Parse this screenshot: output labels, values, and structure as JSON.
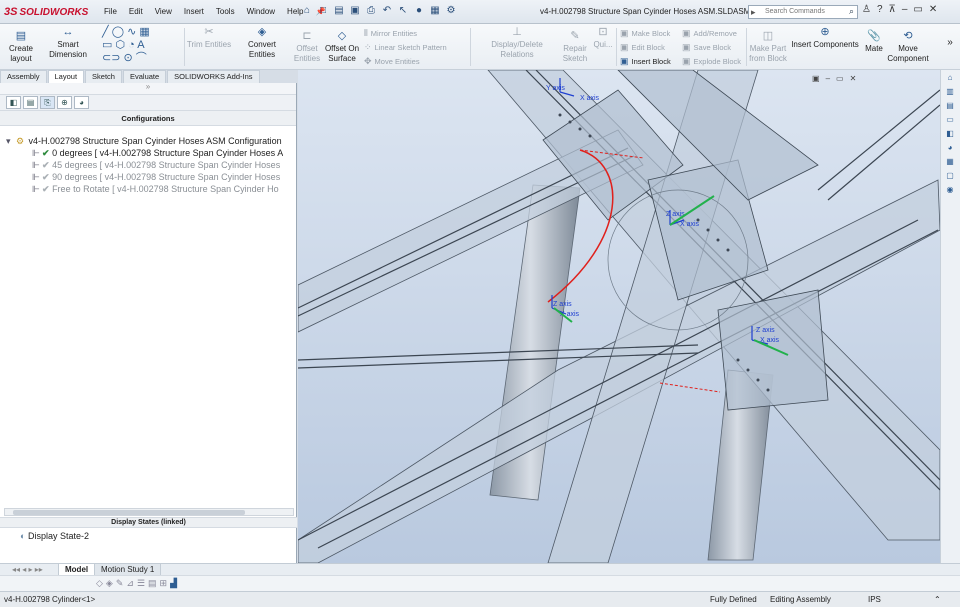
{
  "app": {
    "brand": "SOLIDWORKS",
    "brand_prefix": "3S",
    "accent": "#c8102e"
  },
  "menu": [
    "File",
    "Edit",
    "View",
    "Insert",
    "Tools",
    "Window",
    "Help"
  ],
  "document_title": "v4-H.002798 Structure Span Cyinder Hoses ASM.SLDASM *",
  "search": {
    "placeholder": "Search Commands"
  },
  "ribbon": {
    "create_layout": [
      "Create",
      "layout"
    ],
    "smart_dimension": "Smart Dimension",
    "trim_entities": "Trim Entities",
    "convert_entities": "Convert Entities",
    "offset_entities": [
      "Offset",
      "Entities"
    ],
    "offset_on_surface": [
      "Offset On",
      "Surface"
    ],
    "mirror_entities": "Mirror Entities",
    "linear_sketch_pattern": "Linear Sketch Pattern",
    "move_entities": "Move Entities",
    "display_delete_relations": "Display/Delete Relations",
    "repair_sketch": [
      "Repair",
      "Sketch"
    ],
    "quick_snaps": "Qui...",
    "make_block": "Make Block",
    "edit_block": "Edit Block",
    "insert_block": "Insert Block",
    "add_remove": "Add/Remove",
    "save_block": "Save Block",
    "explode_block": "Explode Block",
    "make_part_from_block": [
      "Make Part",
      "from Block"
    ],
    "insert_components": "Insert Components",
    "mate": "Mate",
    "move_component": [
      "Move",
      "Component"
    ]
  },
  "tabs": [
    "Assembly",
    "Layout",
    "Sketch",
    "Evaluate",
    "SOLIDWORKS Add-Ins"
  ],
  "active_tab": "Layout",
  "feature_manager": {
    "section_title": "Configurations",
    "root": "v4-H.002798 Structure Span Cyinder Hoses ASM Configuration",
    "configs": [
      {
        "label": "0 degrees [ v4-H.002798 Structure Span Cyinder Hoses A",
        "active": true
      },
      {
        "label": "45 degrees [ v4-H.002798 Structure Span Cyinder Hoses",
        "active": false
      },
      {
        "label": "90 degrees [ v4-H.002798 Structure Span Cyinder Hoses",
        "active": false
      },
      {
        "label": "Free to Rotate [ v4-H.002798 Structure Span Cyinder Ho",
        "active": false
      }
    ],
    "display_states_title": "Display States (linked)",
    "display_state": "Display State-2"
  },
  "viewport_labels": [
    "Y axis",
    "Z axis",
    "X axis",
    "Y axis",
    "Z axis",
    "X axis",
    "Y axis",
    "Z axis",
    "X axis",
    "Z axis",
    "X axis"
  ],
  "bottom_tabs": [
    "Model",
    "Motion Study 1"
  ],
  "status": {
    "left": "v4-H.002798 Cylinder<1>",
    "defined": "Fully Defined",
    "mode": "Editing Assembly",
    "units": "IPS"
  }
}
